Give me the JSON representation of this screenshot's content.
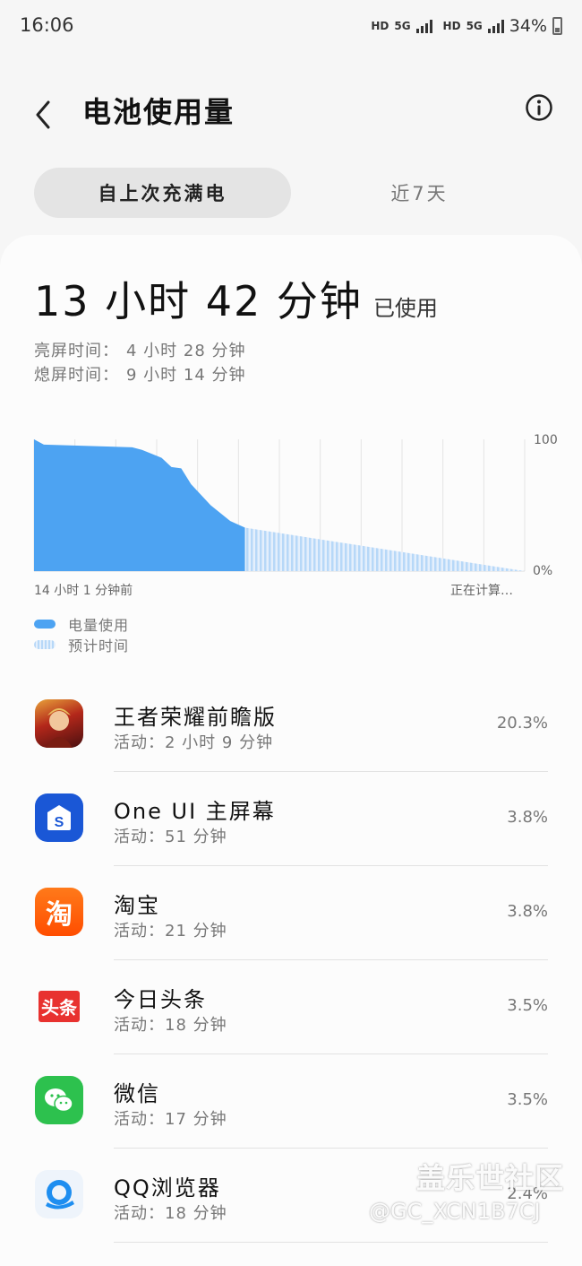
{
  "status_bar": {
    "time": "16:06",
    "hd1": "HD",
    "net1": "5G",
    "hd2": "HD",
    "net2": "5G",
    "battery_pct": "34%"
  },
  "header": {
    "title": "电池使用量"
  },
  "tabs": [
    {
      "label": "自上次充满电",
      "active": true
    },
    {
      "label": "近7天",
      "active": false
    }
  ],
  "summary": {
    "used_time": "13 小时 42 分钟",
    "used_suffix": "已使用",
    "screen_on_label": "亮屏时间：",
    "screen_on_value": "4 小时 28 分钟",
    "screen_off_label": "熄屏时间：",
    "screen_off_value": "9 小时 14 分钟"
  },
  "chart_data": {
    "type": "area",
    "y_max_label": "100",
    "y_min_label": "0%",
    "x_start_label": "14 小时 1 分钟前",
    "x_end_label": "正在计算…",
    "ylim": [
      0,
      100
    ],
    "xlim": [
      0,
      1
    ],
    "series": [
      {
        "name": "电量使用",
        "x": [
          0,
          0.02,
          0.2,
          0.22,
          0.26,
          0.28,
          0.3,
          0.32,
          0.36,
          0.4,
          0.43
        ],
        "y": [
          100,
          96,
          94,
          92,
          86,
          79,
          78,
          66,
          50,
          38,
          33
        ]
      },
      {
        "name": "预计时间",
        "x": [
          0.43,
          1.0
        ],
        "y": [
          33,
          0
        ]
      }
    ],
    "grid": true,
    "colors": {
      "usage": "#4da3f2",
      "predicted": "#b7d8f8"
    }
  },
  "legend": {
    "usage_label": "电量使用",
    "predicted_label": "预计时间"
  },
  "apps": [
    {
      "name": "王者荣耀前瞻版",
      "activity": "活动：2 小时 9 分钟",
      "percent": "20.3%",
      "icon": "game-icon"
    },
    {
      "name": "One UI 主屏幕",
      "activity": "活动：51 分钟",
      "percent": "3.8%",
      "icon": "home-screen-icon"
    },
    {
      "name": "淘宝",
      "activity": "活动：21 分钟",
      "percent": "3.8%",
      "icon": "taobao-icon",
      "icon_text": "淘"
    },
    {
      "name": "今日头条",
      "activity": "活动：18 分钟",
      "percent": "3.5%",
      "icon": "toutiao-icon",
      "icon_text": "头条"
    },
    {
      "name": "微信",
      "activity": "活动：17 分钟",
      "percent": "3.5%",
      "icon": "wechat-icon"
    },
    {
      "name": "QQ浏览器",
      "activity": "活动：18 分钟",
      "percent": "2.4%",
      "icon": "qq-browser-icon"
    }
  ],
  "watermark": {
    "logo": "盖乐世社区",
    "user": "@GC_XCN1B7CJ"
  }
}
